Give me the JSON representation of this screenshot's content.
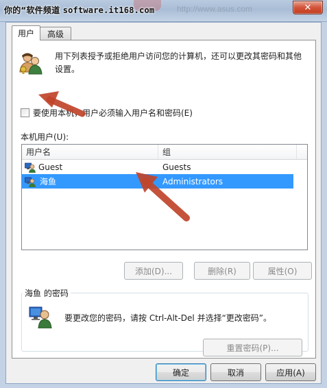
{
  "watermark": {
    "text": "你的“软件频道",
    "site": "software.it168.com"
  },
  "background_url": "http://www.asus.com",
  "window": {
    "close_glyph": "✕"
  },
  "tabs": [
    {
      "label": "用户",
      "active": true
    },
    {
      "label": "高级",
      "active": false
    }
  ],
  "intro": {
    "icon": "users-icon",
    "line1": "用下列表授予或拒绝用户访问您的计算机，还可以更改其密码和其他",
    "line2": "设置。"
  },
  "require_login": {
    "label": "要使用本机，用户必须输入用户名和密码(E)",
    "checked": false
  },
  "users_label": "本机用户(U):",
  "list": {
    "columns": [
      "用户名",
      "组"
    ],
    "rows": [
      {
        "name": "Guest",
        "group": "Guests",
        "selected": false
      },
      {
        "name": "海鱼",
        "group": "Administrators",
        "selected": true
      }
    ],
    "selection_color": "#3399ff"
  },
  "list_buttons": {
    "add": "添加(D)...",
    "remove": "删除(R)",
    "properties": "属性(O)"
  },
  "password_group": {
    "title": "海鱼 的密码",
    "text": "要更改您的密码，请按 Ctrl-Alt-Del 并选择“更改密码”。",
    "reset_button": "重置密码(P)..."
  },
  "dialog_buttons": {
    "ok": "确定",
    "cancel": "取消",
    "apply": "应用(A)"
  },
  "annotation_color": "#c0442a"
}
